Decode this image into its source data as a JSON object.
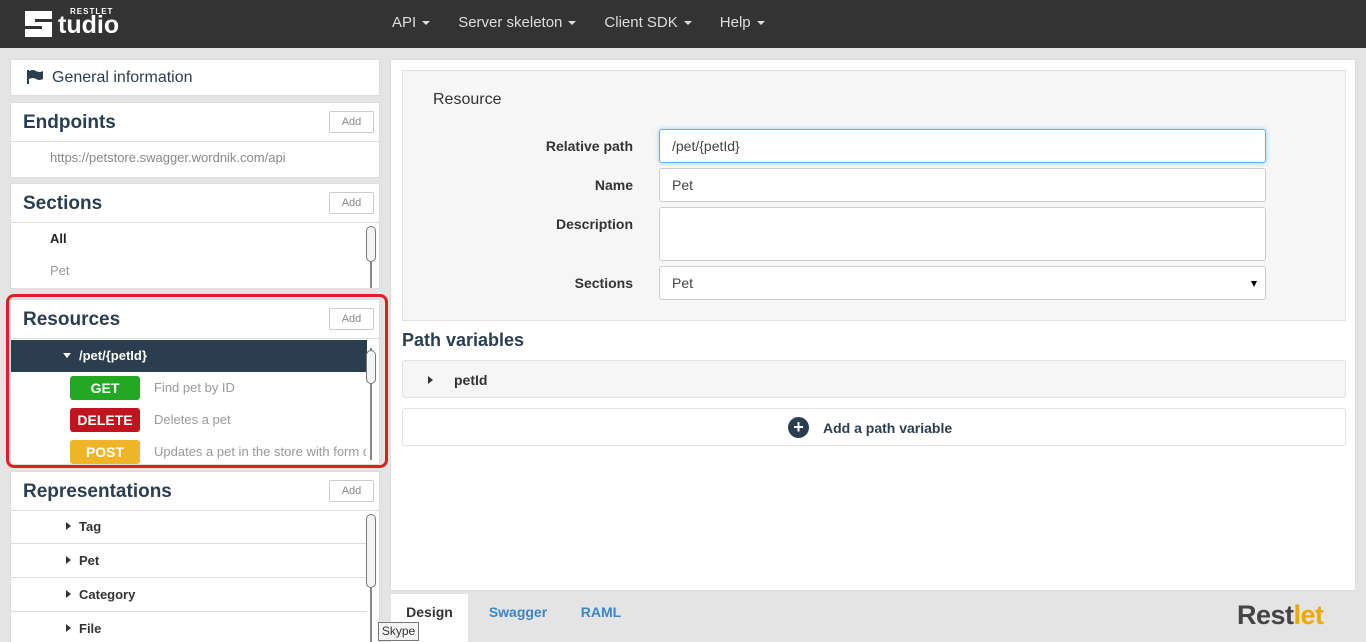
{
  "app": {
    "logo_small": "RESTLET",
    "logo_big": "tudio"
  },
  "nav": {
    "items": [
      {
        "label": "API"
      },
      {
        "label": "Server skeleton"
      },
      {
        "label": "Client SDK"
      },
      {
        "label": "Help"
      }
    ]
  },
  "sidebar": {
    "general": {
      "label": "General information"
    },
    "endpoints": {
      "title": "Endpoints",
      "add_label": "Add",
      "url": "https://petstore.swagger.wordnik.com/api"
    },
    "sections": {
      "title": "Sections",
      "add_label": "Add",
      "items": [
        {
          "label": "All"
        },
        {
          "label": "Pet"
        }
      ]
    },
    "resources": {
      "title": "Resources",
      "add_label": "Add",
      "selected": "/pet/{petId}",
      "methods": [
        {
          "method": "GET",
          "desc": "Find pet by ID",
          "color": "#22a822"
        },
        {
          "method": "DELETE",
          "desc": "Deletes a pet",
          "color": "#c0141e"
        },
        {
          "method": "POST",
          "desc": "Updates a pet in the store with form data",
          "color": "#f0b429"
        }
      ]
    },
    "representations": {
      "title": "Representations",
      "add_label": "Add",
      "items": [
        {
          "label": "Tag"
        },
        {
          "label": "Pet"
        },
        {
          "label": "Category"
        },
        {
          "label": "File"
        }
      ]
    }
  },
  "main": {
    "resource": {
      "title": "Resource",
      "relative_path_label": "Relative path",
      "relative_path_value": "/pet/{petId}",
      "name_label": "Name",
      "name_value": "Pet",
      "description_label": "Description",
      "description_value": "",
      "sections_label": "Sections",
      "sections_value": "Pet"
    },
    "path_variables": {
      "title": "Path variables",
      "items": [
        {
          "name": "petId"
        }
      ],
      "add_label": "Add a path variable"
    }
  },
  "tabs": [
    {
      "label": "Design",
      "active": true
    },
    {
      "label": "Swagger"
    },
    {
      "label": "RAML"
    }
  ],
  "tooltip": "Skype",
  "footer_logo": {
    "part1": "Rest",
    "part2": "let"
  },
  "colors": {
    "topbar": "#333333",
    "accent_dark": "#2b3e50",
    "highlight_border": "#e02020",
    "link_blue": "#3a87c8"
  }
}
